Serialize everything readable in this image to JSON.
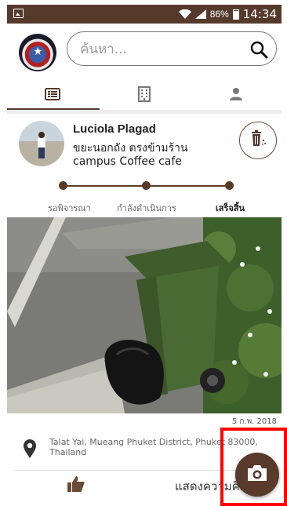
{
  "status_bar": {
    "battery": "86%",
    "time": "14:34"
  },
  "search": {
    "placeholder": "ค้นหา..."
  },
  "tabs": [
    {
      "icon": "list-icon"
    },
    {
      "icon": "building-icon"
    },
    {
      "icon": "person-icon"
    }
  ],
  "post": {
    "user_name": "Luciola Plagad",
    "text": "ขยะนอกถัง ตรงข้ามร้าน campus Coffee cafe",
    "progress": {
      "steps": [
        "รอพิจารณา",
        "กำลังดำเนินการ",
        "เสร็จสิ้น"
      ],
      "current_step": 3
    },
    "date": "5 ก.พ. 2018",
    "location": "Talat Yai, Mueang Phuket District, Phuket 83000, Thailand",
    "actions": {
      "like_icon": "thumbs-up-icon",
      "comment_label": "แสดงความคิดเห็น"
    }
  },
  "fab": {
    "icon": "camera-icon"
  },
  "colors": {
    "brand": "#553a2c",
    "highlight": "#ff0000"
  }
}
